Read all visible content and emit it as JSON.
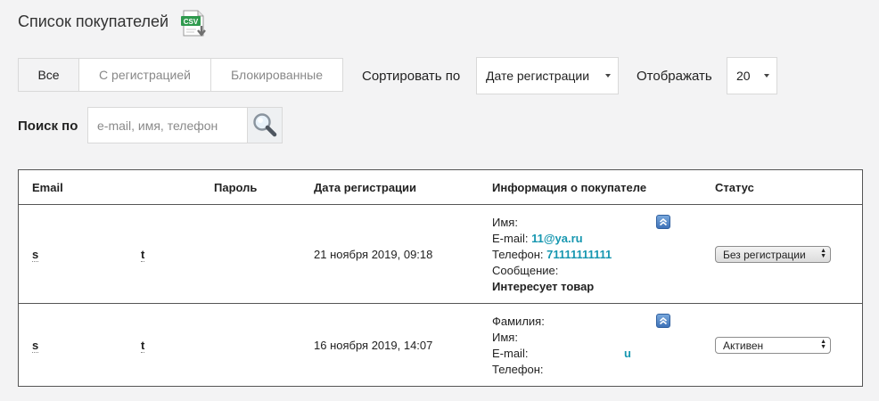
{
  "page": {
    "title": "Список покупателей",
    "csv_icon": "csv-export-icon"
  },
  "filters": [
    {
      "label": "Все",
      "active": true
    },
    {
      "label": "С регистрацией",
      "active": false
    },
    {
      "label": "Блокированные",
      "active": false
    }
  ],
  "sort": {
    "label": "Сортировать по",
    "value": "Дате регистрации"
  },
  "display": {
    "label": "Отображать",
    "value": "20"
  },
  "search": {
    "label": "Поиск по",
    "placeholder": "e-mail, имя, телефон",
    "icon": "magnifier-icon"
  },
  "table": {
    "headers": {
      "email": "Email",
      "password": "Пароль",
      "date": "Дата регистрации",
      "info": "Информация о покупателе",
      "status": "Статус"
    },
    "rows": [
      {
        "email": "s",
        "email2": "t",
        "date": "21 ноября 2019, 09:18",
        "info": {
          "name_label": "Имя:",
          "email_label": "E-mail:",
          "email_value": "11@ya.ru",
          "phone_label": "Телефон:",
          "phone_value": "71111111111",
          "message_label": "Сообщение:",
          "message_value": "Интересует товар"
        },
        "status": "Без регистрации"
      },
      {
        "email": "s",
        "email2": "t",
        "date": "16 ноября 2019, 14:07",
        "info": {
          "surname_label": "Фамилия:",
          "name_label": "Имя:",
          "email_label": "E-mail:",
          "email_value": "u",
          "phone_label": "Телефон:"
        },
        "status": "Активен"
      }
    ]
  },
  "colors": {
    "link": "#1797b0",
    "background": "#f3f3f4",
    "border": "#d9d9d9"
  }
}
